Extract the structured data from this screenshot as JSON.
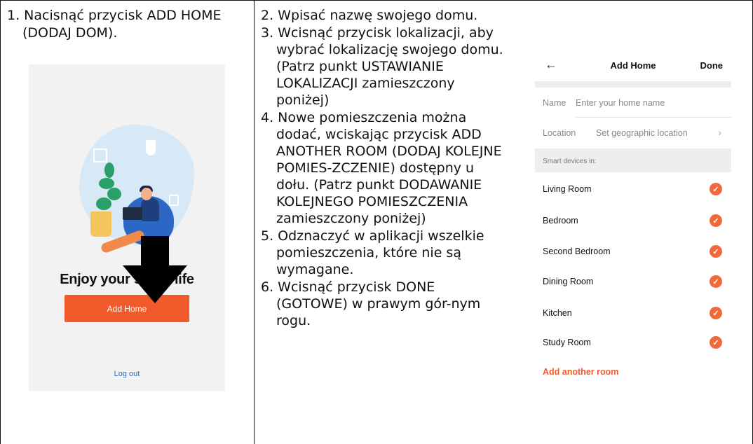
{
  "col1": {
    "steps": [
      "1. Nacisnąć przycisk ADD HOME (DODAJ DOM)."
    ]
  },
  "col2": {
    "steps": [
      "2. Wpisać nazwę swojego domu.",
      "3. Wcisnąć przycisk lokalizacji, aby wybrać lokalizację swojego domu. (Patrz punkt USTAWIANIE LOKALIZACJI zamieszczony poniżej)",
      "4. Nowe pomieszczenia można dodać, wciskając przycisk ADD ANOTHER ROOM (DODAJ KOLEJNE POMIES-ZCZENIE) dostępny u dołu. (Patrz punkt DODAWANIE KOLEJNEGO POMIESZCZENIA zamieszczony poniżej)",
      "5. Odznaczyć w aplikacji wszelkie pomieszczenia, które nie są wymagane.",
      "6. Wcisnąć przycisk DONE (GOTOWE) w prawym gór-nym rogu."
    ]
  },
  "left_phone": {
    "headline": "Enjoy your smart life",
    "add_home_label": "Add Home",
    "logout_label": "Log out"
  },
  "right_phone": {
    "back_icon": "arrow-left-icon",
    "title": "Add Home",
    "done_label": "Done",
    "name_label": "Name",
    "name_placeholder": "Enter your home name",
    "location_label": "Location",
    "location_value": "Set geographic location",
    "section_header": "Smart devices in:",
    "rooms": [
      "Living Room",
      "Bedroom",
      "Second Bedroom",
      "Dining Room",
      "Kitchen",
      "Study Room"
    ],
    "add_room_label": "Add another room",
    "accent": "#f15a2b"
  }
}
